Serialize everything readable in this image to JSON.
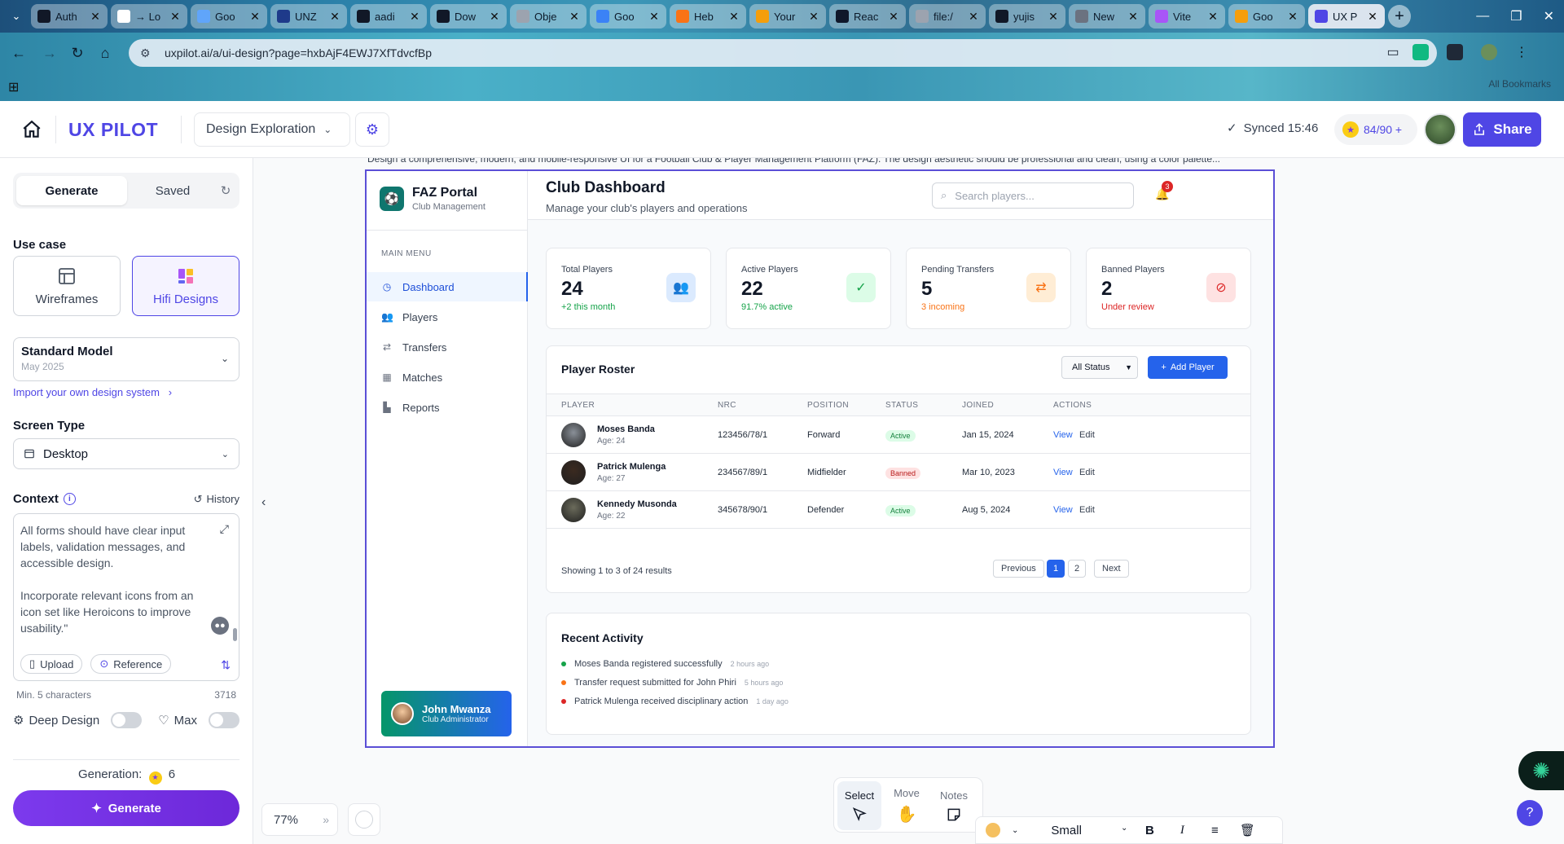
{
  "browser": {
    "tabs": [
      {
        "title": "Auth",
        "fav": "#111827"
      },
      {
        "title": "→ Lo",
        "fav": "#ffffff"
      },
      {
        "title": "Goo",
        "fav": "#60a5fa"
      },
      {
        "title": "UNZ",
        "fav": "#1e3a8a"
      },
      {
        "title": "aadi",
        "fav": "#111827"
      },
      {
        "title": "Dow",
        "fav": "#111827"
      },
      {
        "title": "Obje",
        "fav": "#9ca3af"
      },
      {
        "title": "Goo",
        "fav": "#3b82f6"
      },
      {
        "title": "Heb",
        "fav": "#f97316"
      },
      {
        "title": "Your",
        "fav": "#f59e0b"
      },
      {
        "title": "Reac",
        "fav": "#0f172a"
      },
      {
        "title": "file:/",
        "fav": "#9ca3af"
      },
      {
        "title": "yujis",
        "fav": "#111827"
      },
      {
        "title": "New",
        "fav": "#6b7280"
      },
      {
        "title": "Vite",
        "fav": "#a855f7"
      },
      {
        "title": "Goo",
        "fav": "#f59e0b"
      },
      {
        "title": "UX P",
        "fav": "#4f46e5",
        "active": true
      }
    ],
    "url": "uxpilot.ai/a/ui-design?page=hxbAjF4EWJ7XfTdvcfBp",
    "all_bookmarks": "All Bookmarks"
  },
  "header": {
    "logo": "UX PILOT",
    "project": "Design Exploration",
    "synced": "Synced 15:46",
    "credits": "84/90 +",
    "share": "Share"
  },
  "left": {
    "tab_generate": "Generate",
    "tab_saved": "Saved",
    "use_case_label": "Use case",
    "use_case_wireframes": "Wireframes",
    "use_case_hifi": "Hifi Designs",
    "model_name": "Standard Model",
    "model_date": "May 2025",
    "import_link": "Import your own design system",
    "screen_type_label": "Screen Type",
    "screen_type_value": "Desktop",
    "context_label": "Context",
    "history": "History",
    "context_text": "All forms should have clear input labels, validation messages, and accessible design.\n\nIncorporate relevant icons from an icon set like Heroicons to improve usability.\"",
    "upload": "Upload",
    "reference": "Reference",
    "min_chars": "Min. 5 characters",
    "char_count": "3718",
    "deep_design": "Deep Design",
    "max": "Max",
    "generation_label": "Generation:",
    "generation_cost": "6",
    "generate_button": "Generate"
  },
  "canvas": {
    "caption": "Design a comprehensive, modern, and mobile-responsive UI for a Football Club & Player Management Platform (FAZ). The design aesthetic should be professional and clean, using a color palette...",
    "zoom": "77%",
    "modes": [
      "Select",
      "Move",
      "Notes"
    ],
    "text_size": "Small"
  },
  "design": {
    "brand": "FAZ Portal",
    "brand_sub": "Club Management",
    "menu_label": "MAIN MENU",
    "menu": [
      {
        "label": "Dashboard",
        "icon": "dashboard-icon",
        "glyph": "◷",
        "active": true
      },
      {
        "label": "Players",
        "icon": "users-icon",
        "glyph": "👥"
      },
      {
        "label": "Transfers",
        "icon": "transfer-icon",
        "glyph": "⇄"
      },
      {
        "label": "Matches",
        "icon": "calendar-icon",
        "glyph": "▦"
      },
      {
        "label": "Reports",
        "icon": "chart-icon",
        "glyph": "▙"
      }
    ],
    "user_name": "John Mwanza",
    "user_role": "Club Administrator",
    "title": "Club Dashboard",
    "subtitle": "Manage your club's players and operations",
    "search_placeholder": "Search players...",
    "notifications": "3",
    "stats": [
      {
        "label": "Total Players",
        "value": "24",
        "note": "+2 this month",
        "note_color": "#16a34a",
        "icon_bg": "#dbeafe",
        "icon_color": "#2563eb",
        "glyph": "👥",
        "icon": "users-icon"
      },
      {
        "label": "Active Players",
        "value": "22",
        "note": "91.7% active",
        "note_color": "#16a34a",
        "icon_bg": "#dcfce7",
        "icon_color": "#16a34a",
        "glyph": "✓",
        "icon": "user-check-icon"
      },
      {
        "label": "Pending Transfers",
        "value": "5",
        "note": "3 incoming",
        "note_color": "#f97316",
        "icon_bg": "#ffedd5",
        "icon_color": "#f97316",
        "glyph": "⇄",
        "icon": "transfer-icon"
      },
      {
        "label": "Banned Players",
        "value": "2",
        "note": "Under review",
        "note_color": "#dc2626",
        "icon_bg": "#fee2e2",
        "icon_color": "#dc2626",
        "glyph": "⊘",
        "icon": "user-ban-icon"
      }
    ],
    "roster_title": "Player Roster",
    "filter": "All Status",
    "add_player": "Add Player",
    "columns": [
      "PLAYER",
      "NRC",
      "POSITION",
      "STATUS",
      "JOINED",
      "ACTIONS"
    ],
    "players": [
      {
        "name": "Moses Banda",
        "age": "Age: 24",
        "nrc": "123456/78/1",
        "position": "Forward",
        "status": "Active",
        "status_kind": "green",
        "joined": "Jan 15, 2024",
        "avatar": "#8a9098"
      },
      {
        "name": "Patrick Mulenga",
        "age": "Age: 27",
        "nrc": "234567/89/1",
        "position": "Midfielder",
        "status": "Banned",
        "status_kind": "red",
        "joined": "Mar 10, 2023",
        "avatar": "#3b2a20"
      },
      {
        "name": "Kennedy Musonda",
        "age": "Age: 22",
        "nrc": "345678/90/1",
        "position": "Defender",
        "status": "Active",
        "status_kind": "green",
        "joined": "Aug 5, 2024",
        "avatar": "#6b6b5b"
      }
    ],
    "view": "View",
    "edit": "Edit",
    "showing": "Showing 1 to 3 of 24 results",
    "prev": "Previous",
    "page1": "1",
    "page2": "2",
    "next": "Next",
    "activity_title": "Recent Activity",
    "activity": [
      {
        "text": "Moses Banda registered successfully",
        "time": "2 hours ago",
        "color": "#16a34a"
      },
      {
        "text": "Transfer request submitted for John Phiri",
        "time": "5 hours ago",
        "color": "#f97316"
      },
      {
        "text": "Patrick Mulenga received disciplinary action",
        "time": "1 day ago",
        "color": "#dc2626"
      }
    ]
  }
}
